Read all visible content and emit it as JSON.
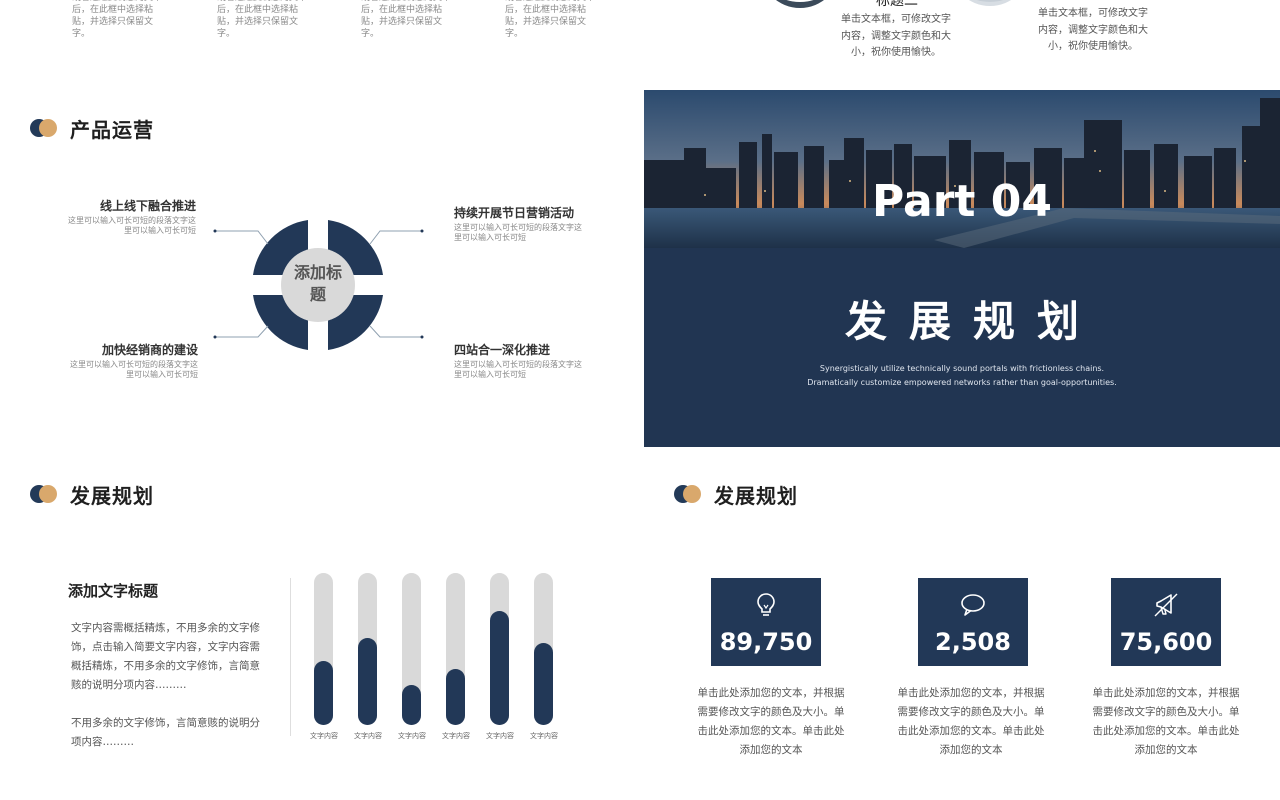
{
  "top_strip": {
    "notes": [
      "或者通过复制您的文本后，在此框中选择粘贴，并选择只保留文字。",
      "或者通过复制您的文本后，在此框中选择粘贴，并选择只保留文字。",
      "或者通过复制您的文本后，在此框中选择粘贴，并选择只保留文字。",
      "或者通过复制您的文本后，在此框中选择粘贴，并选择只保留文字。"
    ],
    "title_two": "标题二",
    "desc_left": "单击文本框，可修改文字内容，调整文字颜色和大小，祝你使用愉快。",
    "desc_right": "单击文本框，可修改文字内容，调整文字颜色和大小，祝你使用愉快。"
  },
  "product_ops": {
    "title": "产品运营",
    "center_label": "添加标题",
    "items": [
      {
        "title": "线上线下融合推进",
        "desc": "这里可以输入可长可短的段落文字这里可以输入可长可短"
      },
      {
        "title": "持续开展节日营销活动",
        "desc": "这里可以输入可长可短的段落文字这里可以输入可长可短"
      },
      {
        "title": "加快经销商的建设",
        "desc": "这里可以输入可长可短的段落文字这里可以输入可长可短"
      },
      {
        "title": "四站合一深化推进",
        "desc": "这里可以输入可长可短的段落文字这里可以输入可长可短"
      }
    ]
  },
  "part_panel": {
    "part": "Part 04",
    "heading": "发展规划",
    "subtitle": "Synergistically utilize technically sound portals with frictionless chains. Dramatically customize empowered networks rather than goal-opportunities."
  },
  "dev_chart_section": {
    "title": "发展规划",
    "heading": "添加文字标题",
    "para1": "文字内容需概括精炼，不用多余的文字修饰，点击输入简要文字内容，文字内容需概括精炼，不用多余的文字修饰，言简意赅的说明分项内容………",
    "para2": "不用多余的文字修饰，言简意赅的说明分项内容………"
  },
  "chart_data": {
    "type": "bar",
    "categories": [
      "文字内容",
      "文字内容",
      "文字内容",
      "文字内容",
      "文字内容",
      "文字内容"
    ],
    "values": [
      0.42,
      0.57,
      0.26,
      0.37,
      0.75,
      0.54
    ],
    "ylim": [
      0,
      1
    ],
    "colors": {
      "track": "#d9d9d9",
      "fill": "#223857"
    }
  },
  "dev_stats_section": {
    "title": "发展规划",
    "stats": [
      {
        "icon": "lightbulb-icon",
        "value": "89,750",
        "desc": "单击此处添加您的文本，并根据需要修改文字的颜色及大小。单击此处添加您的文本。单击此处添加您的文本"
      },
      {
        "icon": "speech-bubble-icon",
        "value": "2,508",
        "desc": "单击此处添加您的文本，并根据需要修改文字的颜色及大小。单击此处添加您的文本。单击此处添加您的文本"
      },
      {
        "icon": "megaphone-icon",
        "value": "75,600",
        "desc": "单击此处添加您的文本，并根据需要修改文字的颜色及大小。单击此处添加您的文本。单击此处添加您的文本"
      }
    ]
  },
  "colors": {
    "navy": "#223857",
    "tan": "#d9a86c"
  }
}
